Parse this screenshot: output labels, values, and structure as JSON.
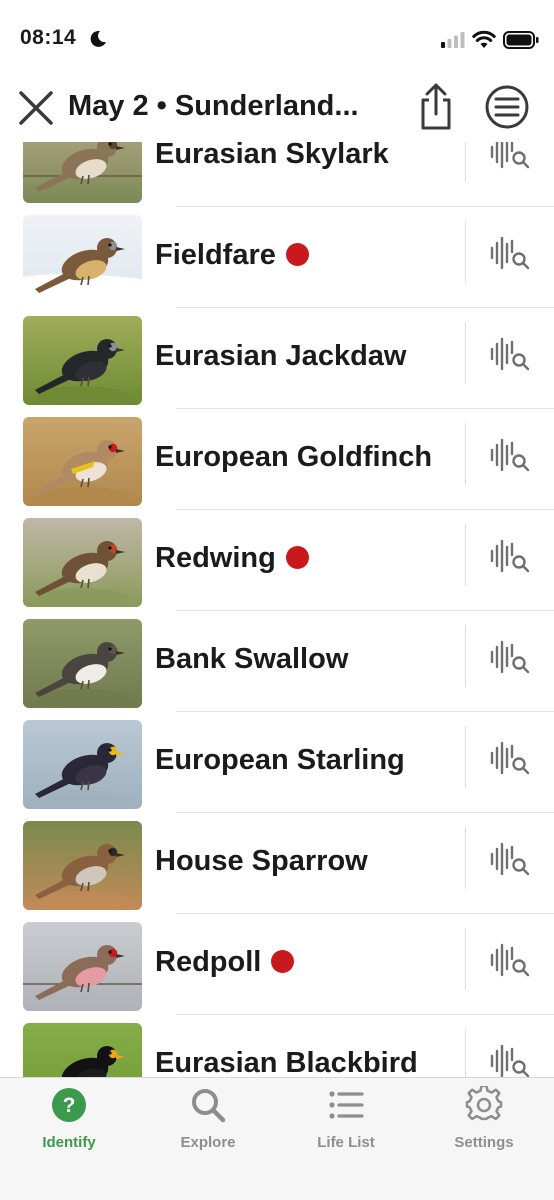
{
  "status_bar": {
    "time": "08:14"
  },
  "header": {
    "title": "May 2 • Sunderland..."
  },
  "colors": {
    "rare_dot": "#c8191e",
    "active_tab": "#3c9a4c",
    "inactive_tab": "#8e8e8e",
    "icon_gray": "#6f6f6f"
  },
  "birds": [
    {
      "name": "Eurasian Skylark",
      "rare": false,
      "thumb": "skylark"
    },
    {
      "name": "Fieldfare",
      "rare": true,
      "thumb": "fieldfare"
    },
    {
      "name": "Eurasian Jackdaw",
      "rare": false,
      "thumb": "jackdaw"
    },
    {
      "name": "European Goldfinch",
      "rare": false,
      "thumb": "goldfinch"
    },
    {
      "name": "Redwing",
      "rare": true,
      "thumb": "redwing"
    },
    {
      "name": "Bank Swallow",
      "rare": false,
      "thumb": "swallow"
    },
    {
      "name": "European Starling",
      "rare": false,
      "thumb": "starling"
    },
    {
      "name": "House Sparrow",
      "rare": false,
      "thumb": "sparrow"
    },
    {
      "name": "Redpoll",
      "rare": true,
      "thumb": "redpoll"
    },
    {
      "name": "Eurasian Blackbird",
      "rare": false,
      "thumb": "blackbird"
    }
  ],
  "tabs": [
    {
      "label": "Identify",
      "icon": "question-circle-icon",
      "active": true
    },
    {
      "label": "Explore",
      "icon": "search-icon",
      "active": false
    },
    {
      "label": "Life List",
      "icon": "list-icon",
      "active": false
    },
    {
      "label": "Settings",
      "icon": "gear-icon",
      "active": false
    }
  ]
}
